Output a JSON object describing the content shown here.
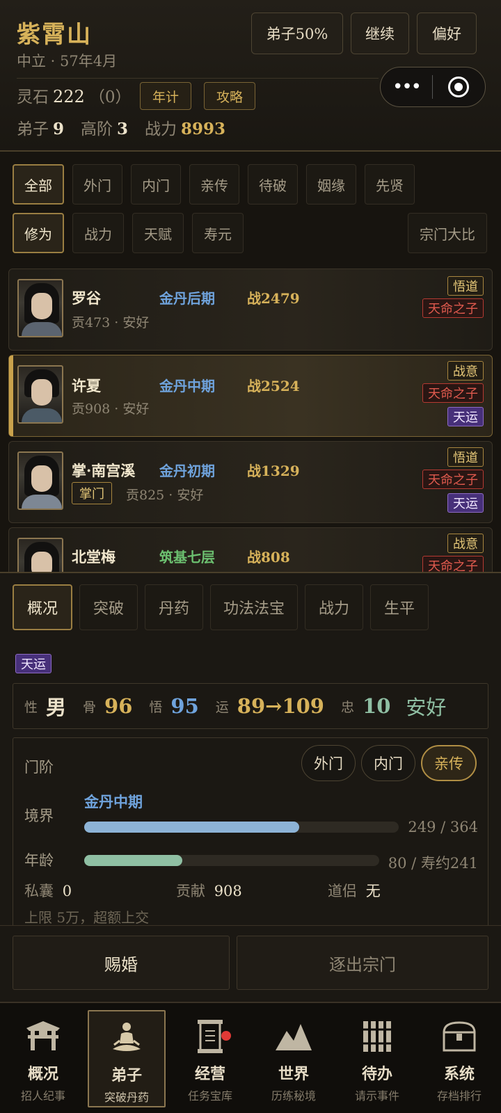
{
  "header": {
    "sect_name": "紫霄山",
    "subtitle": "中立 · 57年4月",
    "buttons": {
      "disciple": "弟子50%",
      "continue": "继续",
      "prefs": "偏好"
    },
    "lingshi_label": "灵石",
    "lingshi_value": "222",
    "lingshi_extra": "（0）",
    "btn_yearly": "年计",
    "btn_guide": "攻略",
    "stats": {
      "disciples_label": "弟子",
      "disciples": "9",
      "high_label": "高阶",
      "high": "3",
      "power_label": "战力",
      "power": "8993"
    },
    "capsule": {
      "more": "•••"
    }
  },
  "filters": {
    "groups": [
      "全部",
      "外门",
      "内门",
      "亲传",
      "待破",
      "姻缘",
      "先贤"
    ],
    "sorts": [
      "修为",
      "战力",
      "天赋",
      "寿元"
    ],
    "contest": "宗门大比"
  },
  "disciples": [
    {
      "name": "罗谷",
      "realm": "金丹后期",
      "power": "战2479",
      "info": "贡473 · 安好",
      "badges": [
        "悟道",
        "天命之子"
      ]
    },
    {
      "name": "许夏",
      "realm": "金丹中期",
      "power": "战2524",
      "info": "贡908 · 安好",
      "badges": [
        "战意",
        "天命之子",
        "天运"
      ]
    },
    {
      "name": "掌·南宫溪",
      "realm": "金丹初期",
      "power": "战1329",
      "tag": "掌门",
      "info": "贡825 · 安好",
      "badges": [
        "悟道",
        "天命之子",
        "天运"
      ]
    },
    {
      "name": "北堂梅",
      "realm": "筑基七层",
      "power": "战808",
      "badges": [
        "战意",
        "天命之子"
      ]
    }
  ],
  "detail": {
    "tabs": [
      "概况",
      "突破",
      "丹药",
      "功法法宝",
      "战力",
      "生平"
    ],
    "luck_badge": "天运",
    "attrs": {
      "gender_label": "性",
      "gender": "男",
      "bone_label": "骨",
      "bone": "96",
      "comp_label": "悟",
      "comp": "95",
      "luck_label": "运",
      "luck": "89→109",
      "loyal_label": "忠",
      "loyal": "10",
      "state": "安好"
    },
    "rank_label": "门阶",
    "ranks": [
      "外门",
      "内门",
      "亲传"
    ],
    "realm_label": "境界",
    "realm": "金丹中期",
    "realm_progress": {
      "current": 249,
      "max": 364,
      "text": "249 / 364"
    },
    "age_label": "年龄",
    "age_progress": {
      "current": 80,
      "max": 241,
      "text": "80 / 寿约241"
    },
    "purse_label": "私囊",
    "purse": "0",
    "contrib_label": "贡献",
    "contrib": "908",
    "partner_label": "道侣",
    "partner": "无",
    "note": "上限 5万，超额上交"
  },
  "actions": {
    "marry": "赐婚",
    "expel": "逐出宗门"
  },
  "nav": [
    {
      "label": "概况",
      "sub": "招人纪事"
    },
    {
      "label": "弟子",
      "sub": "突破丹药"
    },
    {
      "label": "经营",
      "sub": "任务宝库"
    },
    {
      "label": "世界",
      "sub": "历练秘境"
    },
    {
      "label": "待办",
      "sub": "请示事件"
    },
    {
      "label": "系统",
      "sub": "存档排行"
    }
  ],
  "colors": {
    "gold": "#d7b25a",
    "realm_gold": "#6fa3dc",
    "realm_foundation": "#6cc070",
    "bar_realm": "#8db3d6",
    "bar_age": "#8fbfa3"
  }
}
